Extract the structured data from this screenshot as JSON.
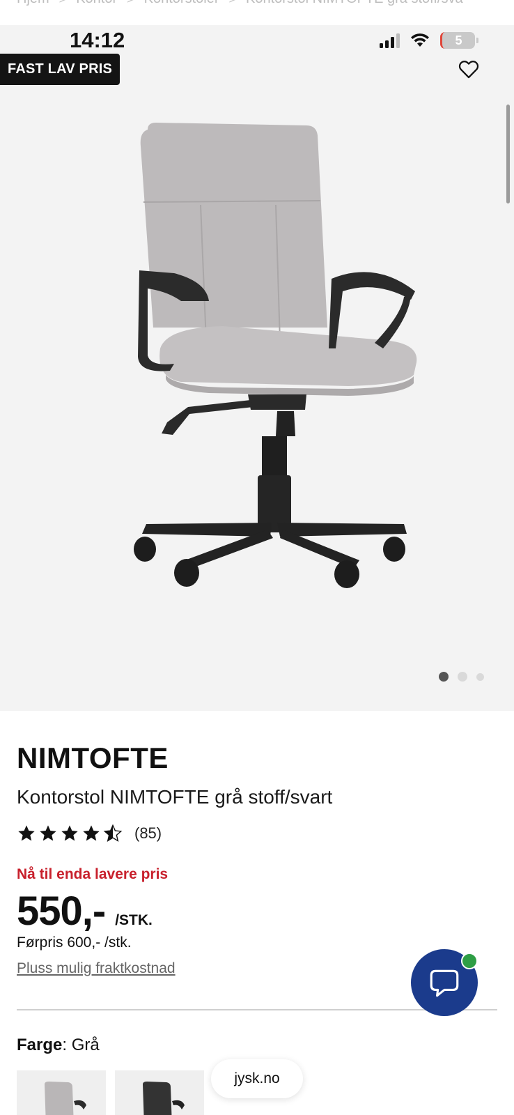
{
  "breadcrumb": {
    "items": [
      "Hjem",
      "Kontor",
      "Kontorstoler",
      "Kontorstol NIMTOFTE grå stoff/sva"
    ],
    "separator": ">"
  },
  "status_bar": {
    "time": "14:12",
    "battery": "5"
  },
  "product": {
    "badge": "FAST LAV PRIS",
    "image_alt": "Kontorstol NIMTOFTE grå stoff/svart",
    "image_dots": {
      "count": 3,
      "active_index": 0
    },
    "brand": "NIMTOFTE",
    "name": "Kontorstol NIMTOFTE grå stoff/svart",
    "rating": {
      "stars": 4.5,
      "max": 5,
      "count": "(85)"
    },
    "promo": "Nå til enda lavere pris",
    "price": "550,-",
    "price_unit": "/STK.",
    "before_price": "Førpris 600,- /stk.",
    "shipping_link": "Pluss mulig fraktkostnad"
  },
  "color": {
    "label": "Farge",
    "value": ": Grå"
  },
  "browser": {
    "url": "jysk.no"
  },
  "icons": {
    "favorite": "heart-icon",
    "chat": "chat-bubble-icon",
    "star": "star-icon"
  },
  "colors": {
    "promo_red": "#c8202c",
    "chat_blue": "#1b3b8c",
    "online_green": "#2e9e45"
  }
}
